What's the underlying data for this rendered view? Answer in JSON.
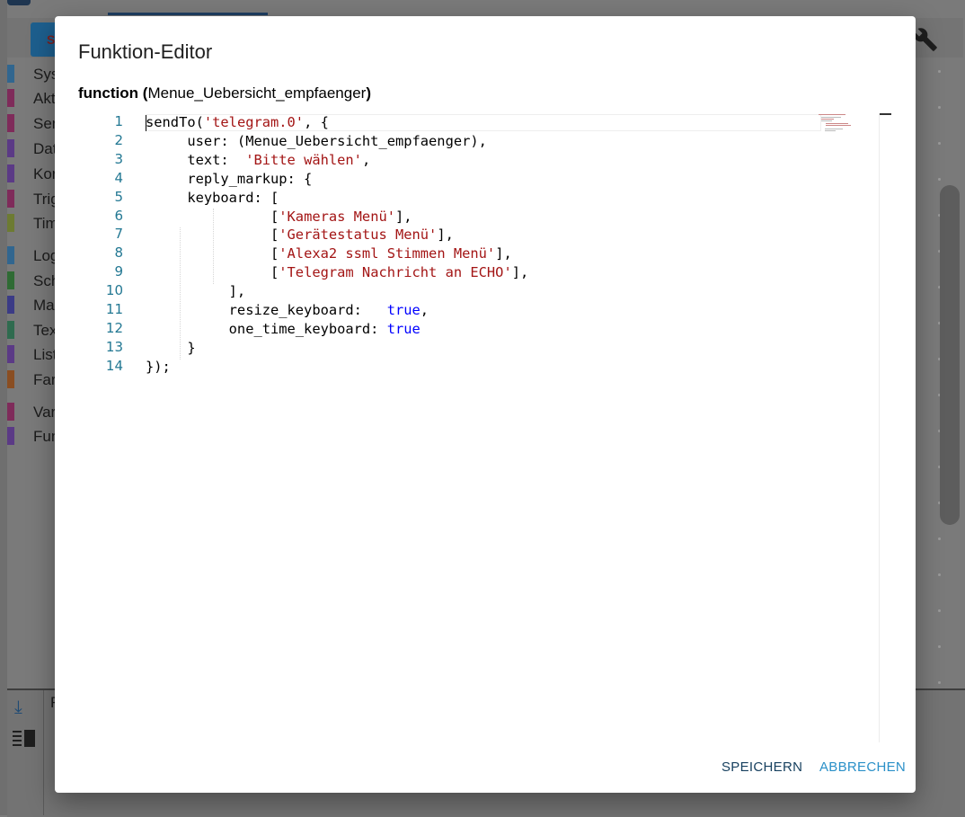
{
  "background": {
    "top_button_label": "S",
    "categories": [
      {
        "label": "Sys",
        "color": "#31668f"
      },
      {
        "label": "Akt",
        "color": "#7f2b5a"
      },
      {
        "label": "Sen",
        "color": "#7f2b5a"
      },
      {
        "label": "Dat",
        "color": "#5b3a86"
      },
      {
        "label": "Kor",
        "color": "#5b3a86"
      },
      {
        "label": "Trig",
        "color": "#7f2b5a"
      },
      {
        "label": "Tim",
        "color": "#6d7b32"
      },
      {
        "label": "Log",
        "color": "#31668f"
      },
      {
        "label": "Sch",
        "color": "#2f6b34"
      },
      {
        "label": "Ma",
        "color": "#3b3b86"
      },
      {
        "label": "Tex",
        "color": "#2f6b4f"
      },
      {
        "label": "List",
        "color": "#5b3a86"
      },
      {
        "label": "Far",
        "color": "#8a4e22"
      },
      {
        "label": "Var",
        "color": "#7f2b5a"
      },
      {
        "label": "Fun",
        "color": "#5b3a86"
      }
    ],
    "bottom_label": "F"
  },
  "dialog": {
    "title": "Funktion-Editor",
    "signature_keyword": "function",
    "signature_open": "(",
    "signature_name": "Menue_Uebersicht_empfaenger",
    "signature_close": ")",
    "save_label": "SPEICHERN",
    "cancel_label": "ABBRECHEN"
  },
  "editor": {
    "line_numbers": [
      "1",
      "2",
      "3",
      "4",
      "5",
      "6",
      "7",
      "8",
      "9",
      "10",
      "11",
      "12",
      "13",
      "14"
    ],
    "lines": [
      [
        {
          "t": "sendTo("
        },
        {
          "t": "'telegram.0'",
          "c": "s"
        },
        {
          "t": ", {"
        }
      ],
      [
        {
          "t": "     user: (Menue_Uebersicht_empfaenger),"
        }
      ],
      [
        {
          "t": "     text:  "
        },
        {
          "t": "'Bitte wählen'",
          "c": "s"
        },
        {
          "t": ","
        }
      ],
      [
        {
          "t": "     reply_markup: {"
        }
      ],
      [
        {
          "t": "     keyboard: ["
        }
      ],
      [
        {
          "t": "               ["
        },
        {
          "t": "'Kameras Menü'",
          "c": "s"
        },
        {
          "t": "],"
        }
      ],
      [
        {
          "t": "               ["
        },
        {
          "t": "'Gerätestatus Menü'",
          "c": "s"
        },
        {
          "t": "],"
        }
      ],
      [
        {
          "t": "               ["
        },
        {
          "t": "'Alexa2 ssml Stimmen Menü'",
          "c": "s"
        },
        {
          "t": "],"
        }
      ],
      [
        {
          "t": "               ["
        },
        {
          "t": "'Telegram Nachricht an ECHO'",
          "c": "s"
        },
        {
          "t": "],"
        }
      ],
      [
        {
          "t": "          ],"
        }
      ],
      [
        {
          "t": "          resize_keyboard:   "
        },
        {
          "t": "true",
          "c": "k"
        },
        {
          "t": ","
        }
      ],
      [
        {
          "t": "          one_time_keyboard: "
        },
        {
          "t": "true",
          "c": "k"
        }
      ],
      [
        {
          "t": "     }"
        }
      ],
      [
        {
          "t": "});"
        }
      ]
    ]
  },
  "colors": {
    "string": "#a31515",
    "keyword": "#0000ff",
    "line_number": "#237893",
    "save_button": "#17405f",
    "cancel_button": "#2a90c8"
  }
}
